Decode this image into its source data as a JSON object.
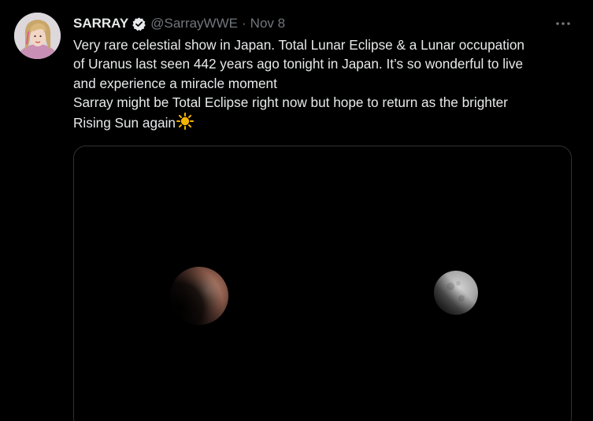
{
  "tweet": {
    "author_name": "SARRAY",
    "author_handle": "@SarrayWWE",
    "separator": "·",
    "timestamp": "Nov 8",
    "verified": true,
    "text_lines": [
      "Very rare celestial show in Japan. Total Lunar Eclipse & a Lunar occupation",
      "of Uranus last seen 442 years ago tonight in Japan. It’s so wonderful to live",
      "and experience a miracle moment",
      "Sarray might be Total Eclipse right now but hope to return as the brighter",
      "Rising Sun again"
    ],
    "emoji": "sun-emoji",
    "more_icon": "ellipsis-icon",
    "media": {
      "type": "photo",
      "subjects": [
        "eclipsed-moon",
        "partial-moon"
      ]
    }
  },
  "colors": {
    "background": "#000000",
    "text_primary": "#e7e9ea",
    "text_secondary": "#71767b",
    "border": "#2f3336",
    "sun": "#f5b400"
  }
}
